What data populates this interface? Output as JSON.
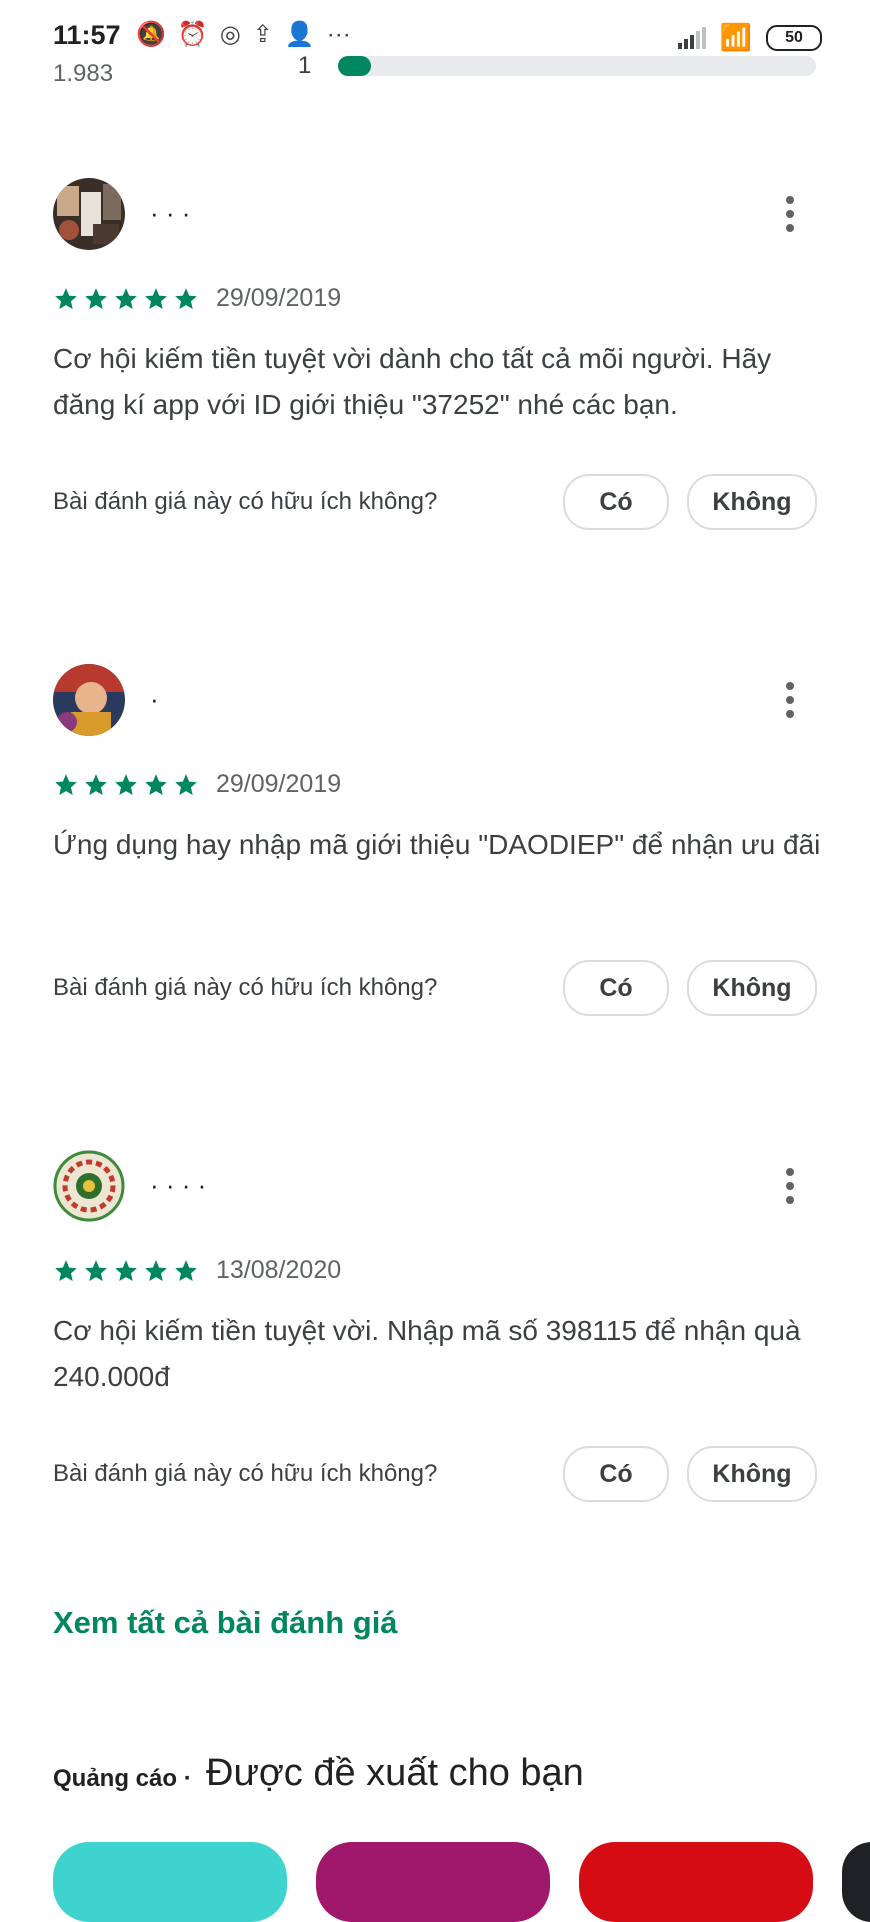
{
  "status_bar": {
    "time": "11:57",
    "battery": "50",
    "icons": [
      "bell-off-icon",
      "alarm-icon",
      "compass-icon",
      "upload-icon",
      "person-add-icon",
      "more-icon"
    ]
  },
  "progress": {
    "count": "1.983",
    "number": "1",
    "fraction": 0.07
  },
  "reviews": [
    {
      "reviewer": "· · ·",
      "stars": 5,
      "date": "29/09/2019",
      "text": "Cơ hội kiếm tiền tuyệt vời dành cho tất cả mõi người. Hãy đăng kí app với ID giới thiệu \"37252\" nhé các bạn.",
      "helpful_question": "Bài đánh giá này có hữu ích không?",
      "yes": "Có",
      "no": "Không"
    },
    {
      "reviewer": "·",
      "stars": 5,
      "date": "29/09/2019",
      "text": "Ứng dụng hay nhập mã giới thiệu \"DAODIEP\" để nhận ưu đãi",
      "helpful_question": "Bài đánh giá này có hữu ích không?",
      "yes": "Có",
      "no": "Không"
    },
    {
      "reviewer": "· · · ·",
      "stars": 5,
      "date": "13/08/2020",
      "text": "Cơ hội kiếm tiền tuyệt vời. Nhập mã số 398115 để nhận quà 240.000đ",
      "helpful_question": "Bài đánh giá này có hữu ích không?",
      "yes": "Có",
      "no": "Không"
    }
  ],
  "see_all": "Xem tất cả bài đánh giá",
  "recommended": {
    "ads_label": "Quảng cáo ·",
    "title": "Được đề xuất cho bạn"
  },
  "colors": {
    "accent": "#01875f",
    "app_tiles": [
      "#3fd3cf",
      "#a0186c",
      "#d50c14",
      "#202124"
    ]
  }
}
